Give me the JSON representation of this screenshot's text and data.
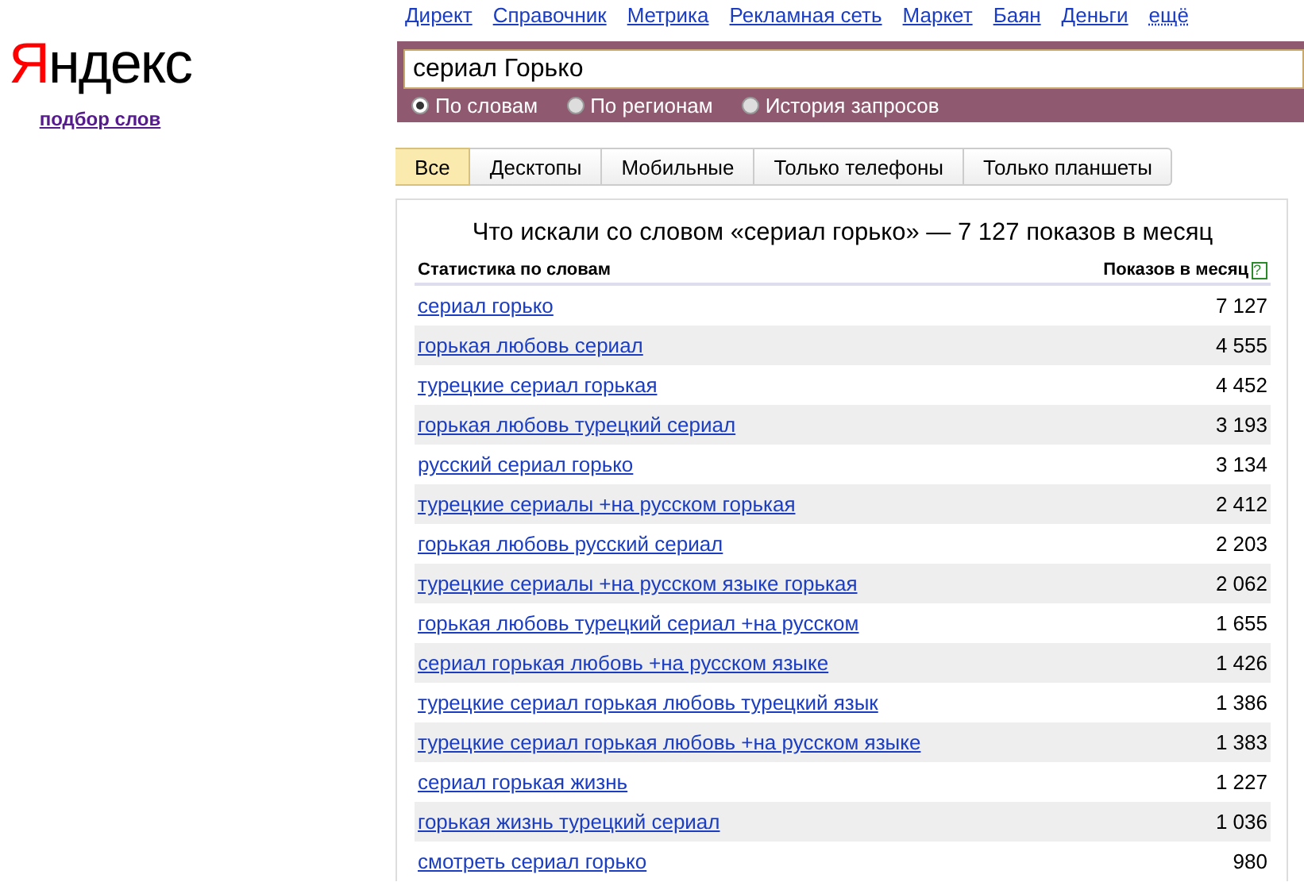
{
  "logo": {
    "text": "Яндекс",
    "link": "подбор слов"
  },
  "nav": [
    "Директ",
    "Справочник",
    "Метрика",
    "Рекламная сеть",
    "Маркет",
    "Баян",
    "Деньги",
    "ещё"
  ],
  "search": {
    "value": "сериал Горько",
    "modes": [
      {
        "label": "По словам",
        "selected": true
      },
      {
        "label": "По регионам",
        "selected": false
      },
      {
        "label": "История запросов",
        "selected": false
      }
    ]
  },
  "tabs": [
    {
      "label": "Все",
      "selected": true
    },
    {
      "label": "Десктопы",
      "selected": false
    },
    {
      "label": "Мобильные",
      "selected": false
    },
    {
      "label": "Только телефоны",
      "selected": false
    },
    {
      "label": "Только планшеты",
      "selected": false
    }
  ],
  "table": {
    "title": "Что искали со словом «сериал горько» — 7 127 показов в месяц",
    "columns": [
      "Статистика по словам",
      "Показов в месяц"
    ],
    "help": "?",
    "rows": [
      {
        "phrase": "сериал горько",
        "count": "7 127"
      },
      {
        "phrase": "горькая любовь сериал",
        "count": "4 555"
      },
      {
        "phrase": "турецкие сериал горькая",
        "count": "4 452"
      },
      {
        "phrase": "горькая любовь турецкий сериал",
        "count": "3 193"
      },
      {
        "phrase": "русский сериал горько",
        "count": "3 134"
      },
      {
        "phrase": "турецкие сериалы +на русском горькая",
        "count": "2 412"
      },
      {
        "phrase": "горькая любовь русский сериал",
        "count": "2 203"
      },
      {
        "phrase": "турецкие сериалы +на русском языке горькая",
        "count": "2 062"
      },
      {
        "phrase": "горькая любовь турецкий сериал +на русском",
        "count": "1 655"
      },
      {
        "phrase": "сериал горькая любовь +на русском языке",
        "count": "1 426"
      },
      {
        "phrase": "турецкие сериал горькая любовь турецкий язык",
        "count": "1 386"
      },
      {
        "phrase": "турецкие сериал горькая любовь +на русском языке",
        "count": "1 383"
      },
      {
        "phrase": "сериал горькая жизнь",
        "count": "1 227"
      },
      {
        "phrase": "горькая жизнь турецкий сериал",
        "count": "1 036"
      },
      {
        "phrase": "смотреть сериал горько",
        "count": "980"
      }
    ]
  }
}
